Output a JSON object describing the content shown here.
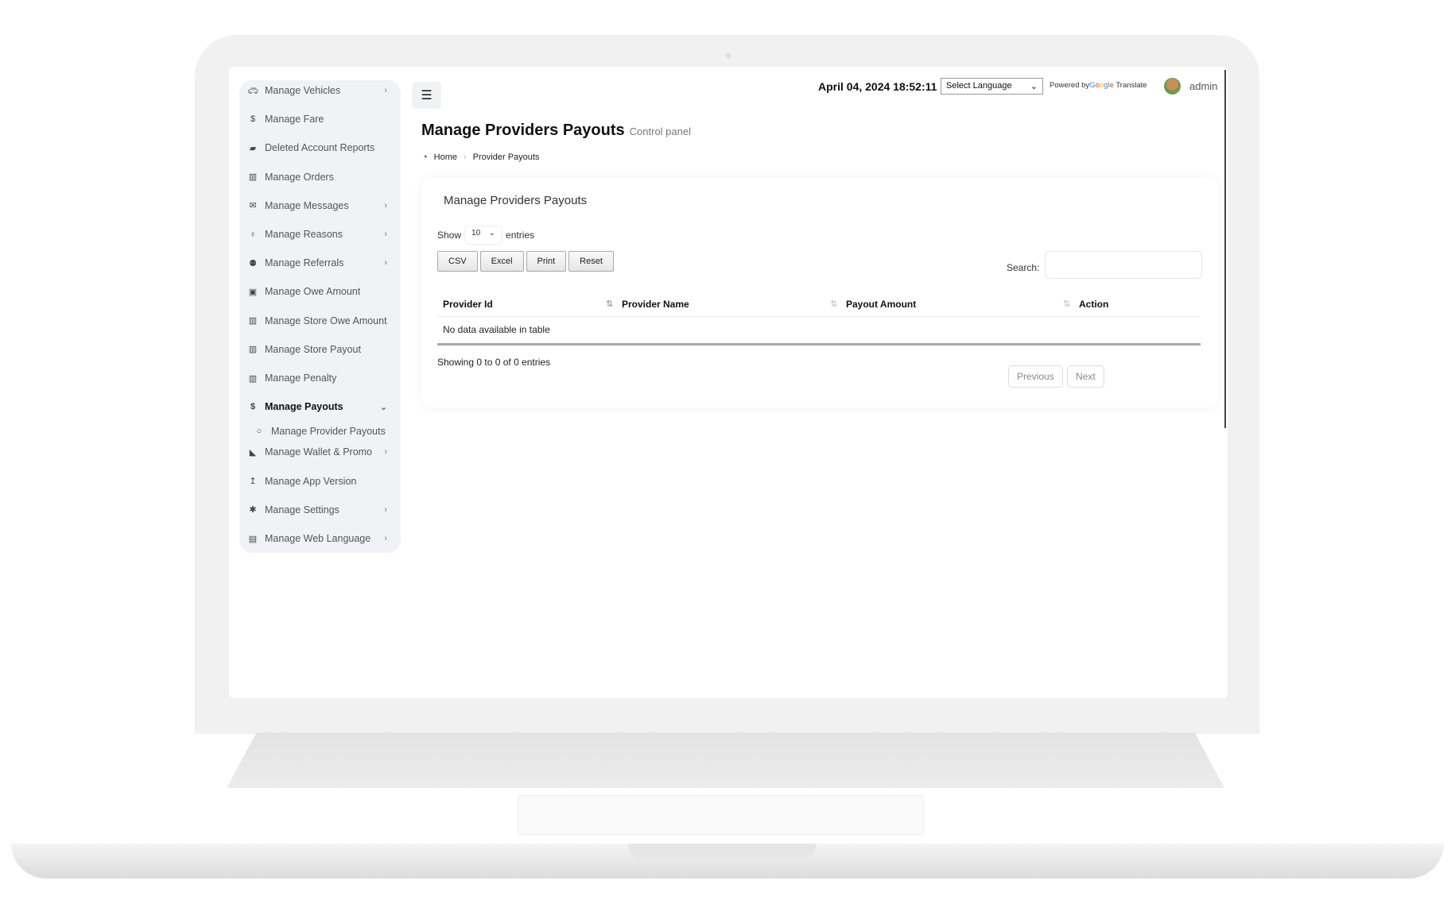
{
  "header": {
    "datetime": "April 04, 2024 18:52:11",
    "language_select": "Select Language",
    "powered_by": "Powered by",
    "google": "Google",
    "translate": "Translate",
    "user": "admin"
  },
  "sidebar": {
    "items": [
      {
        "label": "Manage Vehicles",
        "icon": "car-icon",
        "chevron": true
      },
      {
        "label": "Manage Fare",
        "icon": "dollar-icon",
        "chevron": false
      },
      {
        "label": "Deleted Account Reports",
        "icon": "book-icon",
        "chevron": false
      },
      {
        "label": "Manage Orders",
        "icon": "map-icon",
        "chevron": false
      },
      {
        "label": "Manage Messages",
        "icon": "envelope-icon",
        "chevron": true
      },
      {
        "label": "Manage Reasons",
        "icon": "lightbulb-icon",
        "chevron": true
      },
      {
        "label": "Manage Referrals",
        "icon": "users-icon",
        "chevron": true
      },
      {
        "label": "Manage Owe Amount",
        "icon": "money-icon",
        "chevron": false
      },
      {
        "label": "Manage Store Owe Amount",
        "icon": "map-icon",
        "chevron": false
      },
      {
        "label": "Manage Store Payout",
        "icon": "map-icon",
        "chevron": false
      },
      {
        "label": "Manage Penalty",
        "icon": "map-icon",
        "chevron": false
      },
      {
        "label": "Manage Payouts",
        "icon": "dollar-icon",
        "chevron": true,
        "active": true
      },
      {
        "label": "Manage Provider Payouts",
        "icon": "circle-icon",
        "sub": true
      },
      {
        "label": "Manage Wallet & Promo",
        "icon": "wallet-icon",
        "chevron": true
      },
      {
        "label": "Manage App Version",
        "icon": "upload-icon",
        "chevron": false
      },
      {
        "label": "Manage Settings",
        "icon": "gear-icon",
        "chevron": true
      },
      {
        "label": "Manage Web Language",
        "icon": "language-icon",
        "chevron": true
      }
    ]
  },
  "page": {
    "title": "Manage Providers Payouts",
    "subtitle": "Control panel",
    "breadcrumb": [
      "Home",
      "Provider Payouts"
    ]
  },
  "card": {
    "title": "Manage Providers Payouts",
    "show_label": "Show",
    "entries_value": "10",
    "entries_label": "entries",
    "buttons": [
      "CSV",
      "Excel",
      "Print",
      "Reset"
    ],
    "search_label": "Search:",
    "search_value": "",
    "columns": [
      "Provider Id",
      "Provider Name",
      "Payout Amount",
      "Action"
    ],
    "empty": "No data available in table",
    "info": "Showing 0 to 0 of 0 entries",
    "previous": "Previous",
    "next": "Next"
  }
}
